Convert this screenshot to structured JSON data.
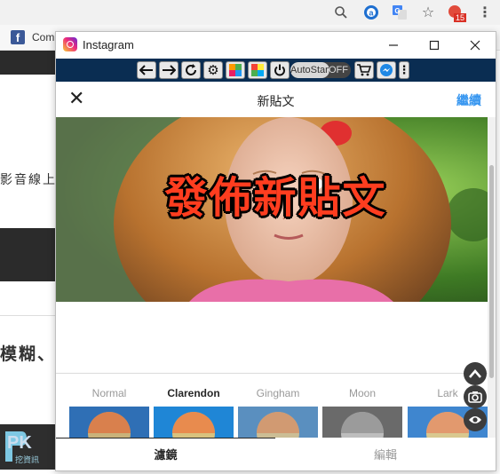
{
  "browser": {
    "bookmark": {
      "label": "Com"
    },
    "badge_count": "15"
  },
  "background_page": {
    "text_line1": "影音線上",
    "text_line2": "模糊、"
  },
  "window": {
    "title": "Instagram"
  },
  "extension_bar": {
    "autostart_label": "AutoStart",
    "off_label": "OFF"
  },
  "app": {
    "title": "新貼文",
    "next_label": "繼續",
    "overlay_text": "發佈新貼文",
    "filters": [
      {
        "name": "Normal",
        "active": false
      },
      {
        "name": "Clarendon",
        "active": true
      },
      {
        "name": "Gingham",
        "active": false
      },
      {
        "name": "Moon",
        "active": false
      },
      {
        "name": "Lark",
        "active": false
      }
    ],
    "tabs": [
      {
        "label": "濾鏡",
        "active": true
      },
      {
        "label": "編輯",
        "active": false
      }
    ]
  },
  "watermark": {
    "brand": "PK",
    "sub": "挖資訊"
  },
  "colors": {
    "accent_blue": "#3897f0",
    "ext_bar": "#0a2d52",
    "overlay_red": "#ff3d1f"
  }
}
